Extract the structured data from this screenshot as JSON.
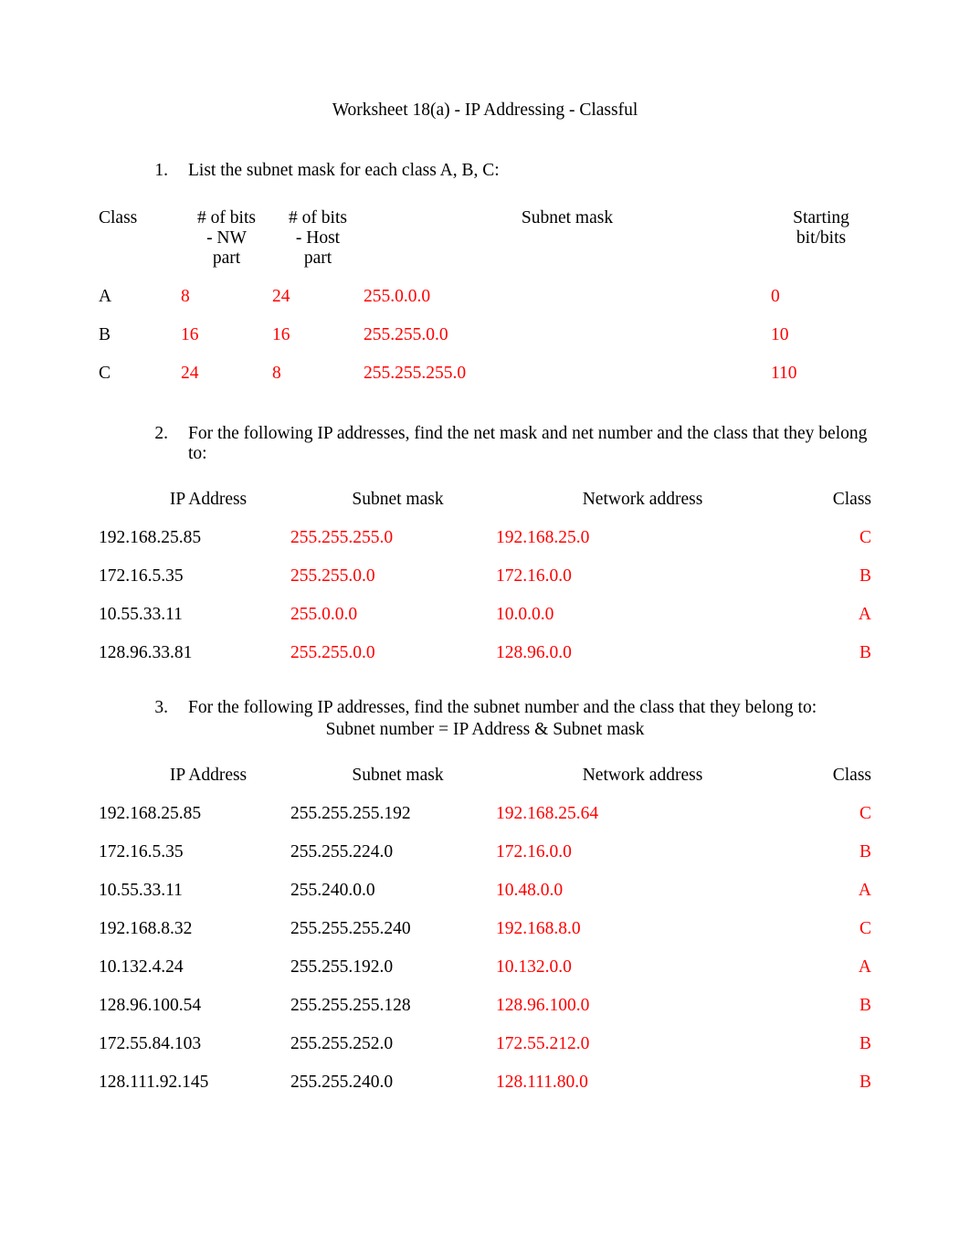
{
  "title": "Worksheet 18(a) - IP Addressing - Classful",
  "q1": {
    "num": "1.",
    "text": "List the subnet mask for each class A, B, C:",
    "headers": {
      "class": "Class",
      "nw_l1": "# of bits",
      "nw_l2": "- NW",
      "nw_l3": "part",
      "host_l1": "# of bits",
      "host_l2": "- Host",
      "host_l3": "part",
      "mask": "Subnet mask",
      "start_l1": "Starting",
      "start_l2": "bit/bits"
    },
    "rows": [
      {
        "class": "A",
        "nw": "8",
        "host": "24",
        "mask": "255.0.0.0",
        "start": "0"
      },
      {
        "class": "B",
        "nw": "16",
        "host": "16",
        "mask": "255.255.0.0",
        "start": "10"
      },
      {
        "class": "C",
        "nw": "24",
        "host": "8",
        "mask": "255.255.255.0",
        "start": "110"
      }
    ]
  },
  "q2": {
    "num": "2.",
    "text": "For the following IP addresses, find the net mask and net number and the class that they belong to:",
    "headers": {
      "ip": "IP Address",
      "mask": "Subnet mask",
      "net": "Network address",
      "class": "Class"
    },
    "rows": [
      {
        "ip": "192.168.25.85",
        "mask": "255.255.255.0",
        "net": "192.168.25.0",
        "class": "C"
      },
      {
        "ip": "172.16.5.35",
        "mask": "255.255.0.0",
        "net": "172.16.0.0",
        "class": "B"
      },
      {
        "ip": "10.55.33.11",
        "mask": "255.0.0.0",
        "net": "10.0.0.0",
        "class": "A"
      },
      {
        "ip": "128.96.33.81",
        "mask": "255.255.0.0",
        "net": "128.96.0.0",
        "class": "B"
      }
    ]
  },
  "q3": {
    "num": "3.",
    "text": "For the following IP addresses, find the subnet number and the class that they belong to:",
    "sub": "Subnet number = IP Address & Subnet mask",
    "headers": {
      "ip": "IP Address",
      "mask": "Subnet mask",
      "net": "Network address",
      "class": "Class"
    },
    "rows": [
      {
        "ip": "192.168.25.85",
        "mask": "255.255.255.192",
        "net": "192.168.25.64",
        "class": "C"
      },
      {
        "ip": "172.16.5.35",
        "mask": "255.255.224.0",
        "net": "172.16.0.0",
        "class": "B"
      },
      {
        "ip": "10.55.33.11",
        "mask": "255.240.0.0",
        "net": "10.48.0.0",
        "class": "A"
      },
      {
        "ip": "192.168.8.32",
        "mask": "255.255.255.240",
        "net": "192.168.8.0",
        "class": "C"
      },
      {
        "ip": "10.132.4.24",
        "mask": "255.255.192.0",
        "net": "10.132.0.0",
        "class": "A"
      },
      {
        "ip": "128.96.100.54",
        "mask": "255.255.255.128",
        "net": "128.96.100.0",
        "class": "B"
      },
      {
        "ip": "172.55.84.103",
        "mask": "255.255.252.0",
        "net": "172.55.212.0",
        "class": "B"
      },
      {
        "ip": "128.111.92.145",
        "mask": "255.255.240.0",
        "net": "128.111.80.0",
        "class": "B"
      }
    ]
  }
}
